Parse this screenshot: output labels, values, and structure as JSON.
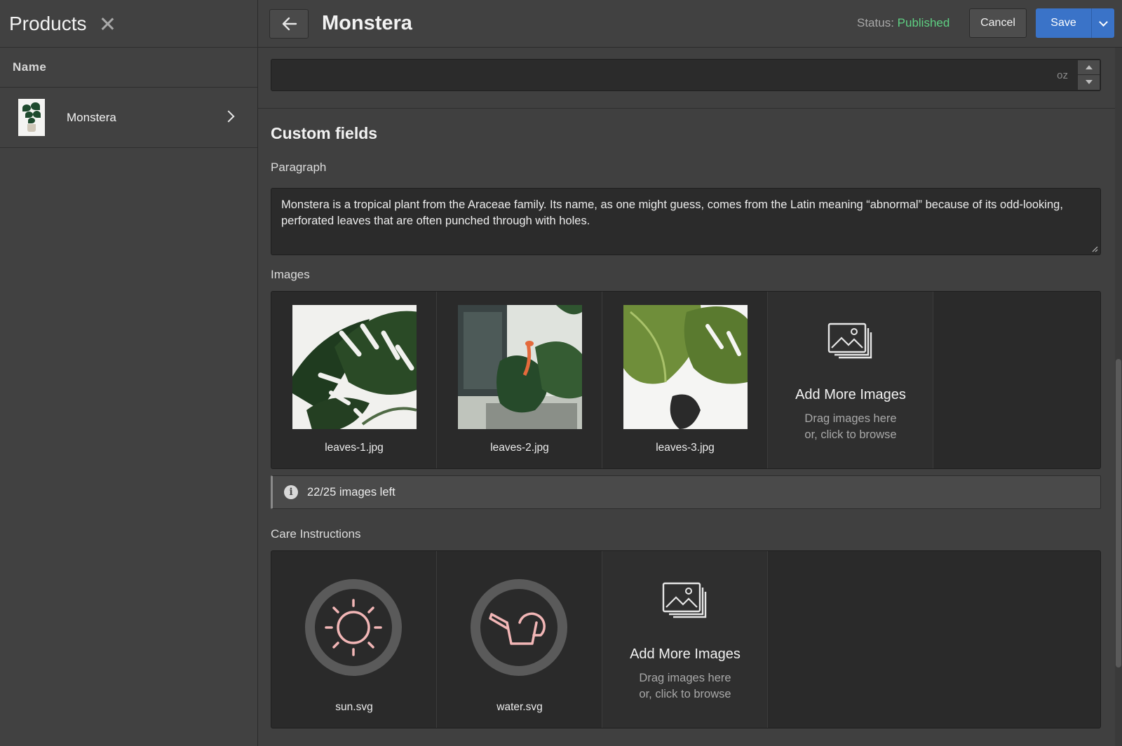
{
  "sidebar": {
    "title": "Products",
    "column_header": "Name",
    "items": [
      {
        "label": "Monstera"
      }
    ]
  },
  "header": {
    "title": "Monstera",
    "status_label": "Status:",
    "status_value": "Published",
    "cancel_label": "Cancel",
    "save_label": "Save"
  },
  "weight_field": {
    "value": "",
    "unit": "oz"
  },
  "custom_fields": {
    "title": "Custom fields",
    "paragraph": {
      "label": "Paragraph",
      "value": "Monstera is a tropical plant from the Araceae family. Its name, as one might guess, comes from the Latin meaning “abnormal” because of its odd-looking, perforated leaves that are often punched through with holes."
    },
    "images": {
      "label": "Images",
      "files": [
        {
          "name": "leaves-1.jpg"
        },
        {
          "name": "leaves-2.jpg"
        },
        {
          "name": "leaves-3.jpg"
        }
      ],
      "add_title": "Add More Images",
      "add_subtitle_line1": "Drag images here",
      "add_subtitle_line2": "or, click to browse",
      "limit_text": "22/25 images left"
    },
    "care": {
      "label": "Care Instructions",
      "files": [
        {
          "name": "sun.svg"
        },
        {
          "name": "water.svg"
        }
      ],
      "add_title": "Add More Images",
      "add_subtitle_line1": "Drag images here",
      "add_subtitle_line2": "or, click to browse"
    }
  },
  "colors": {
    "accent": "#3a73c8",
    "published": "#5ecf82",
    "icon_pink": "#f2b6b6"
  }
}
